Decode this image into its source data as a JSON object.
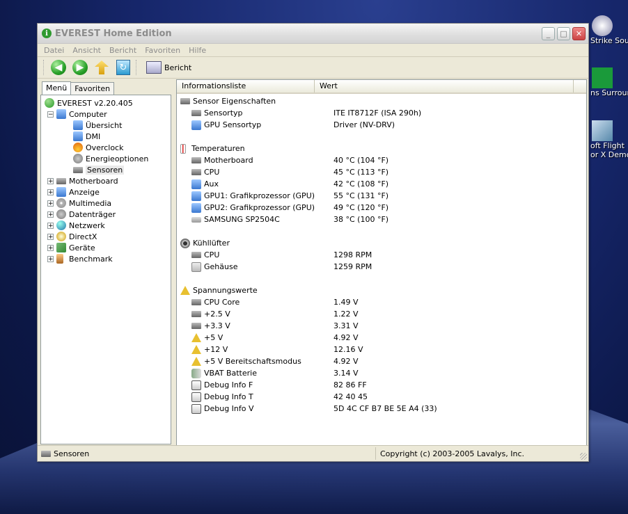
{
  "window": {
    "title": "EVEREST Home Edition",
    "buttons": {
      "minimize": "_",
      "maximize": "□",
      "close": "✕"
    }
  },
  "menubar": [
    "Datei",
    "Ansicht",
    "Bericht",
    "Favoriten",
    "Hilfe"
  ],
  "toolbar": {
    "report_label": "Bericht"
  },
  "tabs": [
    "Menü",
    "Favoriten"
  ],
  "tree": {
    "root": "EVEREST v2.20.405",
    "computer": "Computer",
    "computer_children": [
      "Übersicht",
      "DMI",
      "Overclock",
      "Energieoptionen",
      "Sensoren"
    ],
    "top": [
      "Motherboard",
      "Anzeige",
      "Multimedia",
      "Datenträger",
      "Netzwerk",
      "DirectX",
      "Geräte",
      "Benchmark"
    ]
  },
  "list": {
    "columns": [
      "Informationsliste",
      "Wert"
    ],
    "groups": [
      {
        "label": "Sensor Eigenschaften",
        "items": [
          {
            "name": "Sensortyp",
            "value": "ITE IT8712F  (ISA 290h)"
          },
          {
            "name": "GPU Sensortyp",
            "value": "Driver  (NV-DRV)"
          }
        ]
      },
      {
        "label": "Temperaturen",
        "items": [
          {
            "name": "Motherboard",
            "value": "40 °C  (104 °F)"
          },
          {
            "name": "CPU",
            "value": "45 °C  (113 °F)"
          },
          {
            "name": "Aux",
            "value": "42 °C  (108 °F)"
          },
          {
            "name": "GPU1: Grafikprozessor (GPU)",
            "value": "55 °C  (131 °F)"
          },
          {
            "name": "GPU2: Grafikprozessor (GPU)",
            "value": "49 °C  (120 °F)"
          },
          {
            "name": "SAMSUNG SP2504C",
            "value": "38 °C  (100 °F)"
          }
        ]
      },
      {
        "label": "Kühllüfter",
        "items": [
          {
            "name": "CPU",
            "value": "1298 RPM"
          },
          {
            "name": "Gehäuse",
            "value": "1259 RPM"
          }
        ]
      },
      {
        "label": "Spannungswerte",
        "items": [
          {
            "name": "CPU Core",
            "value": "1.49 V"
          },
          {
            "name": "+2.5 V",
            "value": "1.22 V"
          },
          {
            "name": "+3.3 V",
            "value": "3.31 V"
          },
          {
            "name": "+5 V",
            "value": "4.92 V"
          },
          {
            "name": "+12 V",
            "value": "12.16 V"
          },
          {
            "name": "+5 V Bereitschaftsmodus",
            "value": "4.92 V"
          },
          {
            "name": "VBAT Batterie",
            "value": "3.14 V"
          },
          {
            "name": "Debug Info F",
            "value": "82 86 FF"
          },
          {
            "name": "Debug Info T",
            "value": "42 40 45"
          },
          {
            "name": "Debug Info V",
            "value": "5D 4C CF B7 BE 5E A4 (33)"
          }
        ]
      }
    ]
  },
  "statusbar": {
    "left": "Sensoren",
    "right": "Copyright (c) 2003-2005 Lavalys, Inc."
  },
  "desktop": [
    "Strike Sourc",
    "ns Surround",
    "oft Flight",
    "or X Demo"
  ]
}
